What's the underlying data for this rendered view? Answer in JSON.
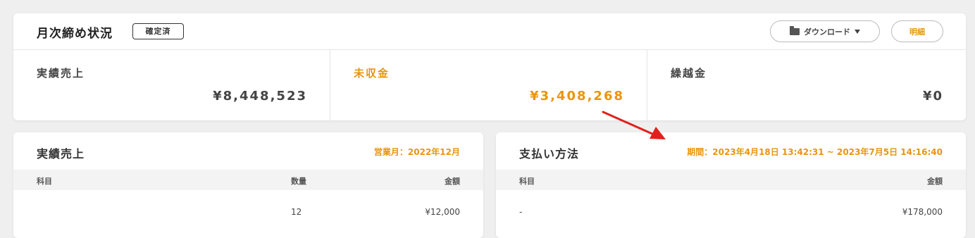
{
  "summary": {
    "title": "月次締め状況",
    "status_badge": "確定済",
    "download_label": "ダウンロード",
    "detail_label": "明細",
    "metrics": [
      {
        "label": "実績売上",
        "value": "¥8,448,523"
      },
      {
        "label": "未収金",
        "value": "¥3,408,268",
        "highlight_color": "#e8950f"
      },
      {
        "label": "繰越金",
        "value": "¥0"
      }
    ]
  },
  "sales": {
    "title": "実績売上",
    "period": "営業月：2022年12月",
    "columns": [
      "科目",
      "数量",
      "金額"
    ],
    "rows": [
      {
        "item": "",
        "quantity": "12",
        "amount": "¥12,000"
      }
    ]
  },
  "payment": {
    "title": "支払い方法",
    "period": "期間：2023年4月18日 13:42:31 ~ 2023年7月5日 14:16:40",
    "columns": [
      "科目",
      "金額"
    ],
    "rows": [
      {
        "item": "-",
        "amount": "¥178,000"
      }
    ]
  },
  "colors": {
    "accent": "#e8950f",
    "annotation": "#e0211b"
  }
}
